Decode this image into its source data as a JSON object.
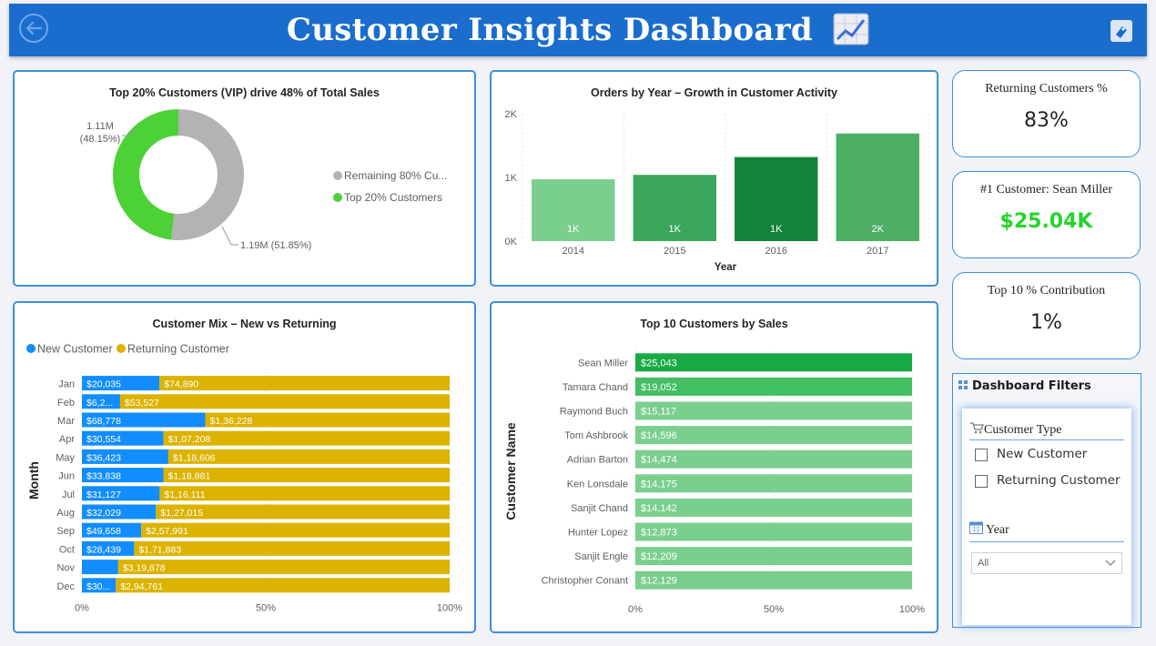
{
  "header": {
    "title": "Customer Insights Dashboard",
    "icons": {
      "back": "back-arrow-icon",
      "title": "chart-increasing-icon",
      "tag": "eraser-icon"
    }
  },
  "colors": {
    "header": "#1a6dcc",
    "border": "#3d8fe0",
    "new_customer": "#118dff",
    "returning_customer": "#dcb300",
    "green_dark": "#14823c",
    "green_mid": "#3aa75a",
    "green_light": "#7bcf8d",
    "gray": "#b3b3b3",
    "kpi_green": "#25d42b"
  },
  "kpis": [
    {
      "label": "Returning Customers %",
      "value": "83%"
    },
    {
      "label": "#1 Customer: Sean Miller",
      "value": "$25.04K"
    },
    {
      "label": "Top 10 % Contribution",
      "value": "1%"
    }
  ],
  "filters": {
    "title": "Dashboard Filters",
    "customer_type_label": "Customer Type",
    "options": [
      "New Customer",
      "Returning Customer"
    ],
    "year_label": "Year",
    "year_value": "All",
    "icons": {
      "head": "grid-icon",
      "customer_type": "cart-icon",
      "year": "calendar-icon",
      "dropdown": "chevron-down-icon"
    }
  },
  "chart_data": [
    {
      "id": "donut",
      "type": "pie",
      "title": "Top 20% Customers (VIP) drive 48% of Total Sales",
      "slices": [
        {
          "name": "Remaining 80% Cu...",
          "value": 1.19,
          "label": "1.19M (51.85%)",
          "color": "#b3b3b3"
        },
        {
          "name": "Top 20% Customers",
          "value": 1.11,
          "label_line1": "1.11M",
          "label_line2": "(48.15%)",
          "color": "#4cd137"
        }
      ]
    },
    {
      "id": "orders",
      "type": "bar",
      "title": "Orders by Year – Growth in Customer Activity",
      "xlabel": "Year",
      "ylabel": "",
      "categories": [
        "2014",
        "2015",
        "2016",
        "2017"
      ],
      "values": [
        970,
        1040,
        1320,
        1690
      ],
      "data_labels": [
        "1K",
        "1K",
        "1K",
        "2K"
      ],
      "colors": [
        "#7bcf8d",
        "#3aa75a",
        "#14823c",
        "#4caf63"
      ],
      "ylim": [
        0,
        2000
      ],
      "yticks": [
        {
          "v": 0,
          "t": "0K"
        },
        {
          "v": 1000,
          "t": "1K"
        },
        {
          "v": 2000,
          "t": "2K"
        }
      ]
    },
    {
      "id": "mix",
      "type": "bar",
      "stacked": "100%",
      "orientation": "horizontal",
      "title": "Customer Mix – New vs Returning",
      "ylabel": "Month",
      "legend": [
        "New Customer",
        "Returning Customer"
      ],
      "categories": [
        "Jan",
        "Feb",
        "Mar",
        "Apr",
        "May",
        "Jun",
        "Jul",
        "Aug",
        "Sep",
        "Oct",
        "Nov",
        "Dec"
      ],
      "series": [
        {
          "name": "New Customer",
          "values": [
            20035,
            6200,
            68778,
            30554,
            36423,
            33838,
            31127,
            32029,
            49658,
            28439,
            35000,
            30000
          ],
          "labels": [
            "$20,035",
            "$6,2...",
            "$68,778",
            "$30,554",
            "$36,423",
            "$33,838",
            "$31,127",
            "$32,029",
            "$49,658",
            "$28,439",
            "",
            "$30..."
          ]
        },
        {
          "name": "Returning Customer",
          "values": [
            74890,
            53527,
            136228,
            107208,
            118606,
            118881,
            116111,
            127015,
            257991,
            171883,
            319878,
            294761
          ],
          "labels": [
            "$74,890",
            "$53,527",
            "$1,36,228",
            "$1,07,208",
            "$1,18,606",
            "$1,18,881",
            "$1,16,111",
            "$1,27,015",
            "$2,57,991",
            "$1,71,883",
            "$3,19,878",
            "$2,94,761"
          ]
        }
      ],
      "xticks": [
        "0%",
        "50%",
        "100%"
      ]
    },
    {
      "id": "top10",
      "type": "bar",
      "orientation": "horizontal",
      "title": "Top 10 Customers by Sales",
      "ylabel": "Customer Name",
      "categories": [
        "Sean Miller",
        "Tamara Chand",
        "Raymond Buch",
        "Tom Ashbrook",
        "Adrian Barton",
        "Ken Lonsdale",
        "Sanjit Chand",
        "Hunter Lopez",
        "Sanjit Engle",
        "Christopher Conant"
      ],
      "values": [
        25043,
        19052,
        15117,
        14596,
        14474,
        14175,
        14142,
        12873,
        12209,
        12129
      ],
      "data_labels": [
        "$25,043",
        "$19,052",
        "$15,117",
        "$14,596",
        "$14,474",
        "$14,175",
        "$14,142",
        "$12,873",
        "$12,209",
        "$12,129"
      ],
      "xticks": [
        "0%",
        "50%",
        "100%"
      ]
    }
  ]
}
